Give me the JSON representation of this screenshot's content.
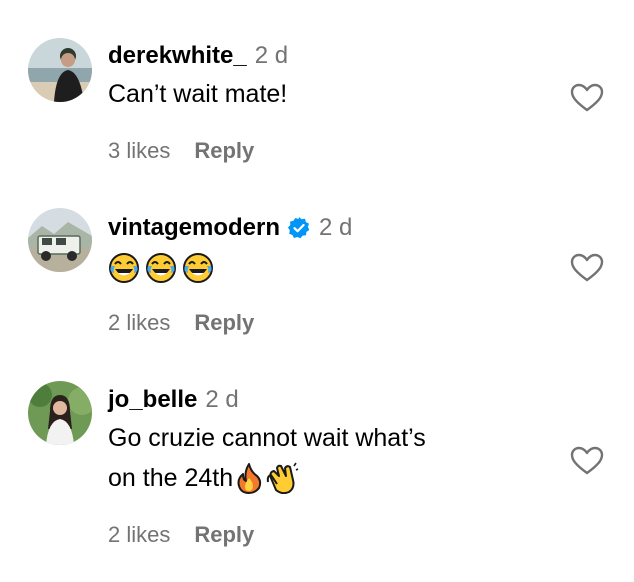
{
  "comments": [
    {
      "username": "derekwhite_",
      "time": "2 d",
      "text": "Can’t wait mate!",
      "likes": "3 likes",
      "reply": "Reply",
      "verified": false,
      "avatar_icon": "beach-person-avatar"
    },
    {
      "username": "vintagemodern",
      "time": "2 d",
      "text": "",
      "emojis": [
        "face-with-tears-of-joy",
        "face-with-tears-of-joy",
        "face-with-tears-of-joy"
      ],
      "likes": "2 likes",
      "reply": "Reply",
      "verified": true,
      "avatar_icon": "vintage-truck-avatar"
    },
    {
      "username": "jo_belle",
      "time": "2 d",
      "text_line1": "Go cruzie cannot wait what’s",
      "text_line2": "on the 24th",
      "emojis": [
        "fire",
        "clapping-hands"
      ],
      "likes": "2 likes",
      "reply": "Reply",
      "verified": false,
      "avatar_icon": "woman-portrait-avatar"
    }
  ],
  "colors": {
    "text": "#000000",
    "secondary": "#737373",
    "verified_blue": "#0095F6"
  },
  "icons": {
    "like": "heart-outline-icon",
    "verified": "verified-badge-icon"
  }
}
